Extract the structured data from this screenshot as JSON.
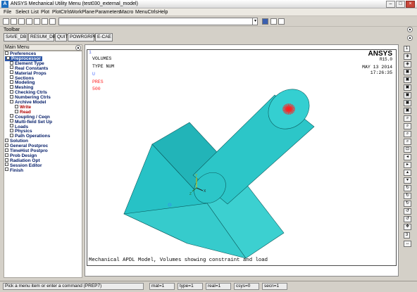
{
  "window": {
    "title": "ANSYS Mechanical Utility Menu (test030_external_model)",
    "icon_letter": "A"
  },
  "menubar": [
    "File",
    "Select",
    "List",
    "Plot",
    "PlotCtrls",
    "WorkPlane",
    "Parameters",
    "Macro",
    "MenuCtrls",
    "Help"
  ],
  "command": {
    "value": ""
  },
  "toolbar": {
    "label": "Toolbar",
    "buttons": [
      "SAVE_DB",
      "RESUM_DB",
      "QUIT",
      "POWRGRPH",
      "E-CAE"
    ]
  },
  "main_menu": {
    "title": "Main Menu",
    "items": [
      {
        "label": "Preferences",
        "level": 0,
        "style": "normal"
      },
      {
        "label": "Preprocessor",
        "level": 0,
        "style": "highlight"
      },
      {
        "label": "Element Type",
        "level": 1,
        "style": "normal"
      },
      {
        "label": "Real Constants",
        "level": 1,
        "style": "normal"
      },
      {
        "label": "Material Props",
        "level": 1,
        "style": "normal"
      },
      {
        "label": "Sections",
        "level": 1,
        "style": "normal"
      },
      {
        "label": "Modeling",
        "level": 1,
        "style": "normal"
      },
      {
        "label": "Meshing",
        "level": 1,
        "style": "normal"
      },
      {
        "label": "Checking Ctrls",
        "level": 1,
        "style": "normal"
      },
      {
        "label": "Numbering Ctrls",
        "level": 1,
        "style": "normal"
      },
      {
        "label": "Archive Model",
        "level": 1,
        "style": "normal"
      },
      {
        "label": "Write",
        "level": 2,
        "style": "red"
      },
      {
        "label": "Read",
        "level": 2,
        "style": "red"
      },
      {
        "label": "Coupling / Ceqn",
        "level": 1,
        "style": "normal"
      },
      {
        "label": "Multi-field Set Up",
        "level": 1,
        "style": "normal"
      },
      {
        "label": "Loads",
        "level": 1,
        "style": "normal"
      },
      {
        "label": "Physics",
        "level": 1,
        "style": "normal"
      },
      {
        "label": "Path Operations",
        "level": 1,
        "style": "normal"
      },
      {
        "label": "Solution",
        "level": 0,
        "style": "normal"
      },
      {
        "label": "General Postproc",
        "level": 0,
        "style": "normal"
      },
      {
        "label": "TimeHist Postpro",
        "level": 0,
        "style": "normal"
      },
      {
        "label": "Prob Design",
        "level": 0,
        "style": "normal"
      },
      {
        "label": "Radiation Opt",
        "level": 0,
        "style": "normal"
      },
      {
        "label": "Session Editor",
        "level": 0,
        "style": "normal"
      },
      {
        "label": "Finish",
        "level": 0,
        "style": "normal"
      }
    ]
  },
  "graphics": {
    "window_number": "1",
    "line1": "VOLUMES",
    "line2": "TYPE NUM",
    "line3": "U",
    "load_label": "PRES",
    "load_value": "500",
    "brand": "ANSYS",
    "release": "R15.0",
    "date": "MAY 13 2014",
    "time": "17:26:35",
    "caption": "Mechanical APDL Model, Volumes showing constraint and load",
    "triad": {
      "y": "Y",
      "x": "X",
      "z": "Z"
    }
  },
  "right_toolbar": {
    "dropdown1": "1",
    "dropdown2": "3"
  },
  "status": {
    "prompt": "Pick a menu item or enter a command (PREP7)",
    "mat": "mat=1",
    "type": "type=1",
    "real": "real=1",
    "csys": "csys=0",
    "secn": "secn=1"
  },
  "colors": {
    "body": "#2ec4c4",
    "body_dark": "#1fa3a6",
    "load": "#ff2020",
    "highlight": "#2d57a8"
  }
}
